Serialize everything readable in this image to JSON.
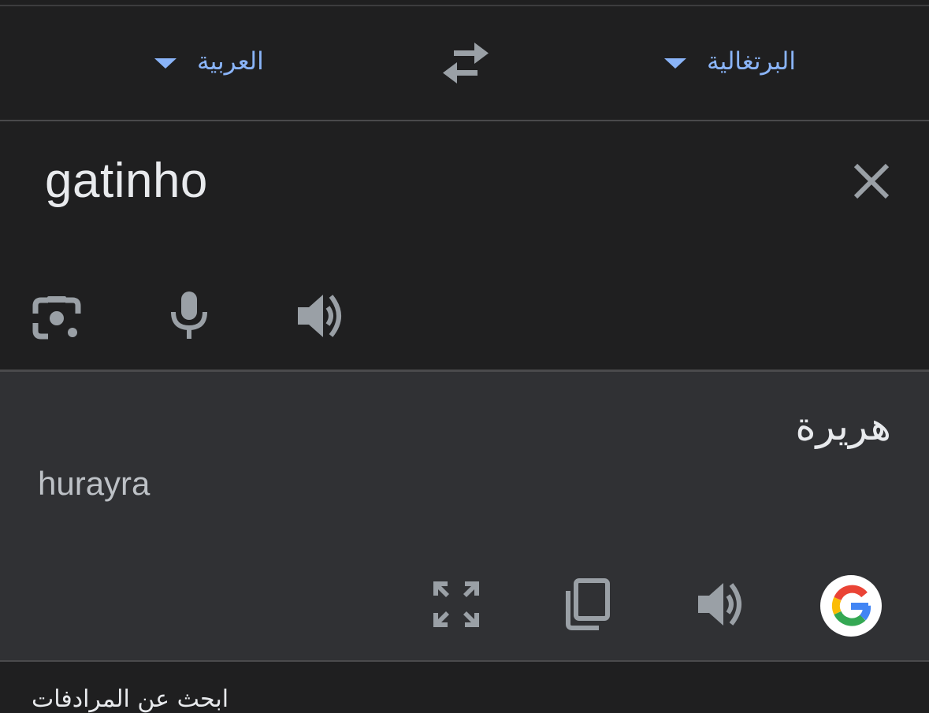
{
  "language_bar": {
    "target_language": "العربية",
    "source_language": "البرتغالية",
    "swap_icon": "swap-arrows-icon",
    "caret_icon": "triangle-down-icon"
  },
  "input": {
    "source_text": "gatinho",
    "clear_icon": "close-icon",
    "tools": [
      "camera-lens-icon",
      "microphone-icon",
      "speaker-icon"
    ]
  },
  "output": {
    "translation": "هريرة",
    "transliteration": "hurayra",
    "tools": [
      "fullscreen-icon",
      "copy-icon",
      "speaker-icon",
      "google-logo-icon"
    ]
  },
  "bottom": {
    "partial_text": "ابحث عن المرادفات"
  },
  "colors": {
    "background": "#1f1f20",
    "output_background": "#303134",
    "accent": "#8ab4f8",
    "icon": "#9aa0a6",
    "text": "#e8eaed"
  }
}
